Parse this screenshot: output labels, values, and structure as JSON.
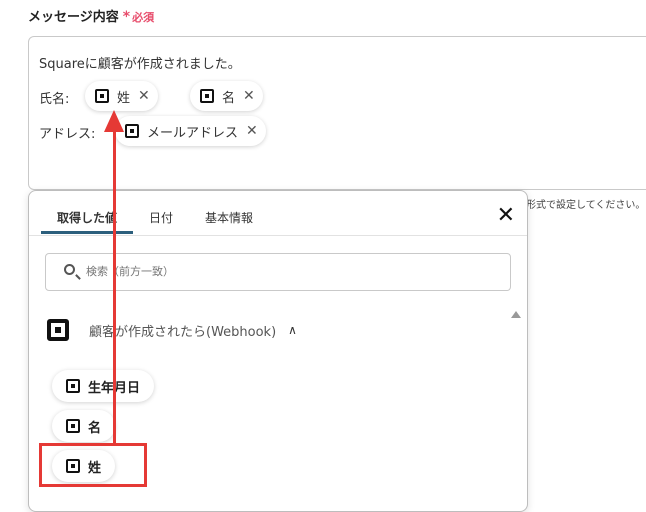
{
  "field": {
    "label": "メッセージ内容",
    "required_star": "*",
    "required_text": "必須"
  },
  "message": {
    "line1": "Squareに顧客が作成されました。",
    "name_label": "氏名:",
    "address_label": "アドレス:",
    "chips": {
      "last_name": "姓",
      "first_name": "名",
      "email": "メールアドレス"
    }
  },
  "helper_text": "形式で設定してください。",
  "panel": {
    "tabs": [
      "取得した値",
      "日付",
      "基本情報"
    ],
    "search_placeholder": "検索（前方一致）",
    "group_title": "顧客が作成されたら(Webhook)",
    "items": [
      "生年月日",
      "名",
      "姓"
    ]
  },
  "icons": {
    "square": "square-logo-icon",
    "close": "close-icon",
    "search": "search-icon",
    "caret": "chevron-up-icon"
  },
  "colors": {
    "required": "#e74c6b",
    "tab_underline": "#2c5f7d",
    "annotation": "#e53935"
  }
}
